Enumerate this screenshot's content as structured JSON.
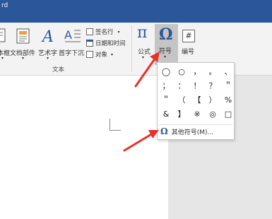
{
  "titlebar": {
    "title_fragment": "rd"
  },
  "ribbon": {
    "textbox_label": "本框",
    "quickparts_label": "文档部件",
    "wordart_label": "艺术字",
    "dropcap_label": "首字下沉",
    "signature_label": "签名行",
    "datetime_label": "日期和时间",
    "object_label": "对象",
    "equation_label": "公式",
    "symbol_label": "符号",
    "number_label": "编号",
    "text_group_label": "文本",
    "equation_glyph": "π",
    "symbol_glyph": "Ω",
    "number_glyph": "#"
  },
  "symbols": [
    "◯",
    "○",
    "，",
    "。",
    "、",
    "；",
    "：",
    "！",
    "？",
    "＂",
    "＂",
    "（",
    "【",
    "）",
    "%",
    "&",
    "】",
    "※",
    "◎",
    "□"
  ],
  "more_symbols": {
    "icon": "Ω",
    "label": "其他符号(M)..."
  },
  "colors": {
    "title_bar": "#2b579a",
    "arrow": "#e8312a",
    "symbol_icon": "#2b579a"
  }
}
